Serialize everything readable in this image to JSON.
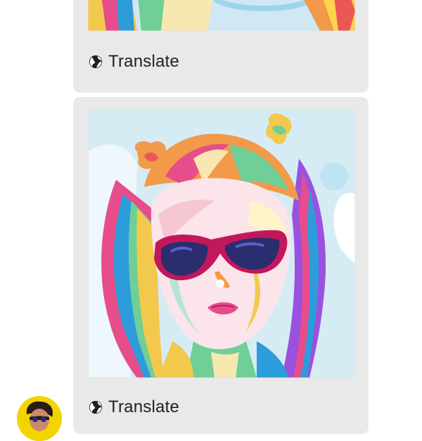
{
  "messages": [
    {
      "image_alt": "colorful pop-art portrait (cropped)",
      "translate_label": "Translate",
      "icon": "globe-icon"
    },
    {
      "image_alt": "colorful pop-art portrait of a girl with pigtails and sunglasses",
      "translate_label": "Translate",
      "icon": "globe-icon"
    }
  ],
  "avatar": {
    "icon": "user-avatar",
    "accent": "#f3d400"
  },
  "colors": {
    "bubble": "#e9e9e9",
    "text": "#222222",
    "page": "#ffffff"
  }
}
